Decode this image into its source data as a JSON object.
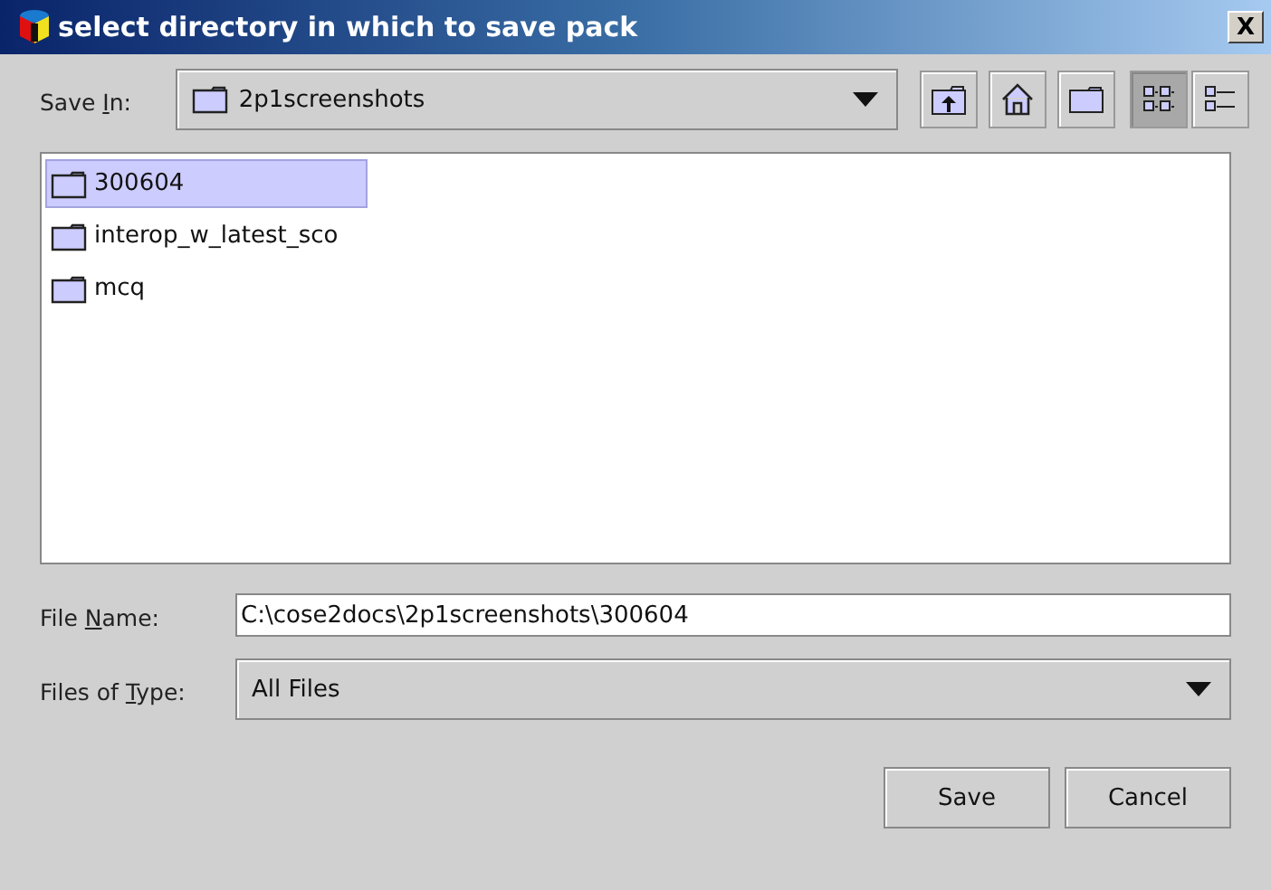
{
  "window": {
    "title": "select directory in which to save pack",
    "close": "X"
  },
  "save_in": {
    "label": {
      "before": "Save ",
      "mnemonic": "I",
      "after": "n:"
    },
    "value": "2p1screenshots"
  },
  "toolbar": [
    {
      "kind": "up",
      "selected": false
    },
    {
      "kind": "home",
      "selected": false
    },
    {
      "kind": "newfolder",
      "selected": false
    },
    {
      "kind": "list",
      "selected": true
    },
    {
      "kind": "details",
      "selected": false
    }
  ],
  "files": [
    {
      "name": "300604",
      "selected": true
    },
    {
      "name": "interop_w_latest_sco",
      "selected": false
    },
    {
      "name": "mcq",
      "selected": false
    }
  ],
  "file_name": {
    "label": {
      "before": "File ",
      "mnemonic": "N",
      "after": "ame:"
    },
    "value": "C:\\cose2docs\\2p1screenshots\\300604"
  },
  "file_type": {
    "label": {
      "before": "Files of ",
      "mnemonic": "T",
      "after": "ype:"
    },
    "value": "All Files"
  },
  "buttons": [
    "Save",
    "Cancel"
  ]
}
